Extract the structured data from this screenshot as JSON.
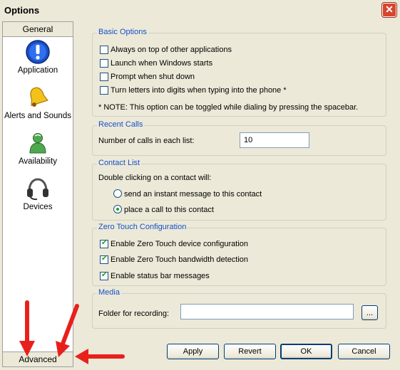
{
  "window": {
    "title": "Options",
    "close_glyph": "✕"
  },
  "sidebar": {
    "header": "General",
    "footer": "Advanced",
    "items": [
      {
        "label": "Application",
        "icon": "info-icon"
      },
      {
        "label": "Alerts and Sounds",
        "icon": "bell-icon"
      },
      {
        "label": "Availability",
        "icon": "person-icon"
      },
      {
        "label": "Devices",
        "icon": "headset-icon"
      }
    ]
  },
  "basic_options": {
    "title": "Basic Options",
    "options": [
      {
        "label": "Always on top of other applications",
        "checked": false
      },
      {
        "label": "Launch when Windows starts",
        "checked": false
      },
      {
        "label": "Prompt when shut down",
        "checked": false
      },
      {
        "label": "Turn letters into digits when typing into the phone *",
        "checked": false
      }
    ],
    "note": "* NOTE: This option can be toggled while dialing by pressing the spacebar."
  },
  "recent_calls": {
    "title": "Recent Calls",
    "label": "Number of calls in each list:",
    "value": "10"
  },
  "contact_list": {
    "title": "Contact List",
    "prompt": "Double clicking on a contact will:",
    "choices": [
      {
        "label": "send an instant message to this contact",
        "selected": false
      },
      {
        "label": "place a call to this contact",
        "selected": true
      }
    ]
  },
  "zero_touch": {
    "title": "Zero Touch Configuration",
    "options": [
      {
        "label": "Enable Zero Touch device configuration",
        "checked": true
      },
      {
        "label": "Enable Zero Touch bandwidth detection",
        "checked": true
      },
      {
        "label": "Enable status bar messages",
        "checked": true
      }
    ]
  },
  "media": {
    "title": "Media",
    "label": "Folder for recording:",
    "value": "",
    "browse_label": "..."
  },
  "buttons": {
    "apply": "Apply",
    "revert": "Revert",
    "ok": "OK",
    "cancel": "Cancel"
  },
  "colors": {
    "group_title": "#1550c8",
    "annotation_arrow": "#e8201c",
    "check": "#21a121"
  }
}
